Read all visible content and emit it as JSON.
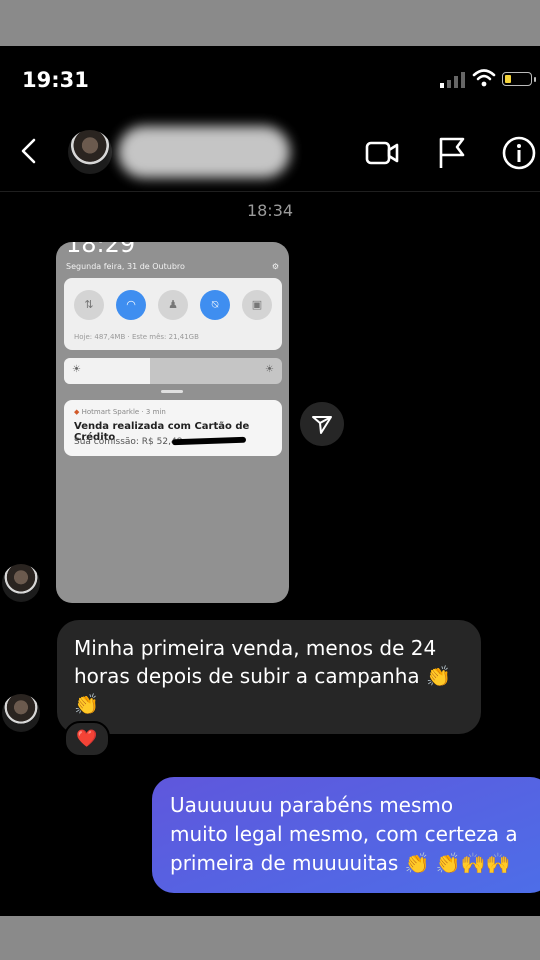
{
  "status_bar": {
    "time": "19:31",
    "icons": [
      "signal-icon",
      "wifi-icon",
      "battery-low-icon"
    ]
  },
  "header": {
    "back_icon": "chevron-left-icon",
    "actions": [
      "video-call-icon",
      "flag-icon",
      "info-icon"
    ]
  },
  "conversation": {
    "timestamp": "18:34",
    "shared_screenshot": {
      "time": "18:29",
      "date": "Segunda feira, 31 de Outubro",
      "data_usage": "Hoje: 487,4MB · Este mês: 21,41GB",
      "notification": {
        "app": "Hotmart Sparkle · 3 min",
        "title": "Venda realizada com Cartão de Crédito",
        "body": "Sua comissão: R$ 52,48"
      }
    },
    "incoming_message": "Minha primeira venda, menos de 24\nhoras depois de subir a campanha 👏\n👏",
    "reaction": "❤️",
    "outgoing_message": "Uauuuuuu parabéns mesmo\nmuito legal mesmo, com certeza a\nprimeira de muuuuitas 👏 👏🙌🙌"
  },
  "colors": {
    "background": "#000000",
    "incoming_bubble": "#262626",
    "outgoing_bubble": "#5b5bd6",
    "quick_toggle_on": "#3f8ef0"
  }
}
